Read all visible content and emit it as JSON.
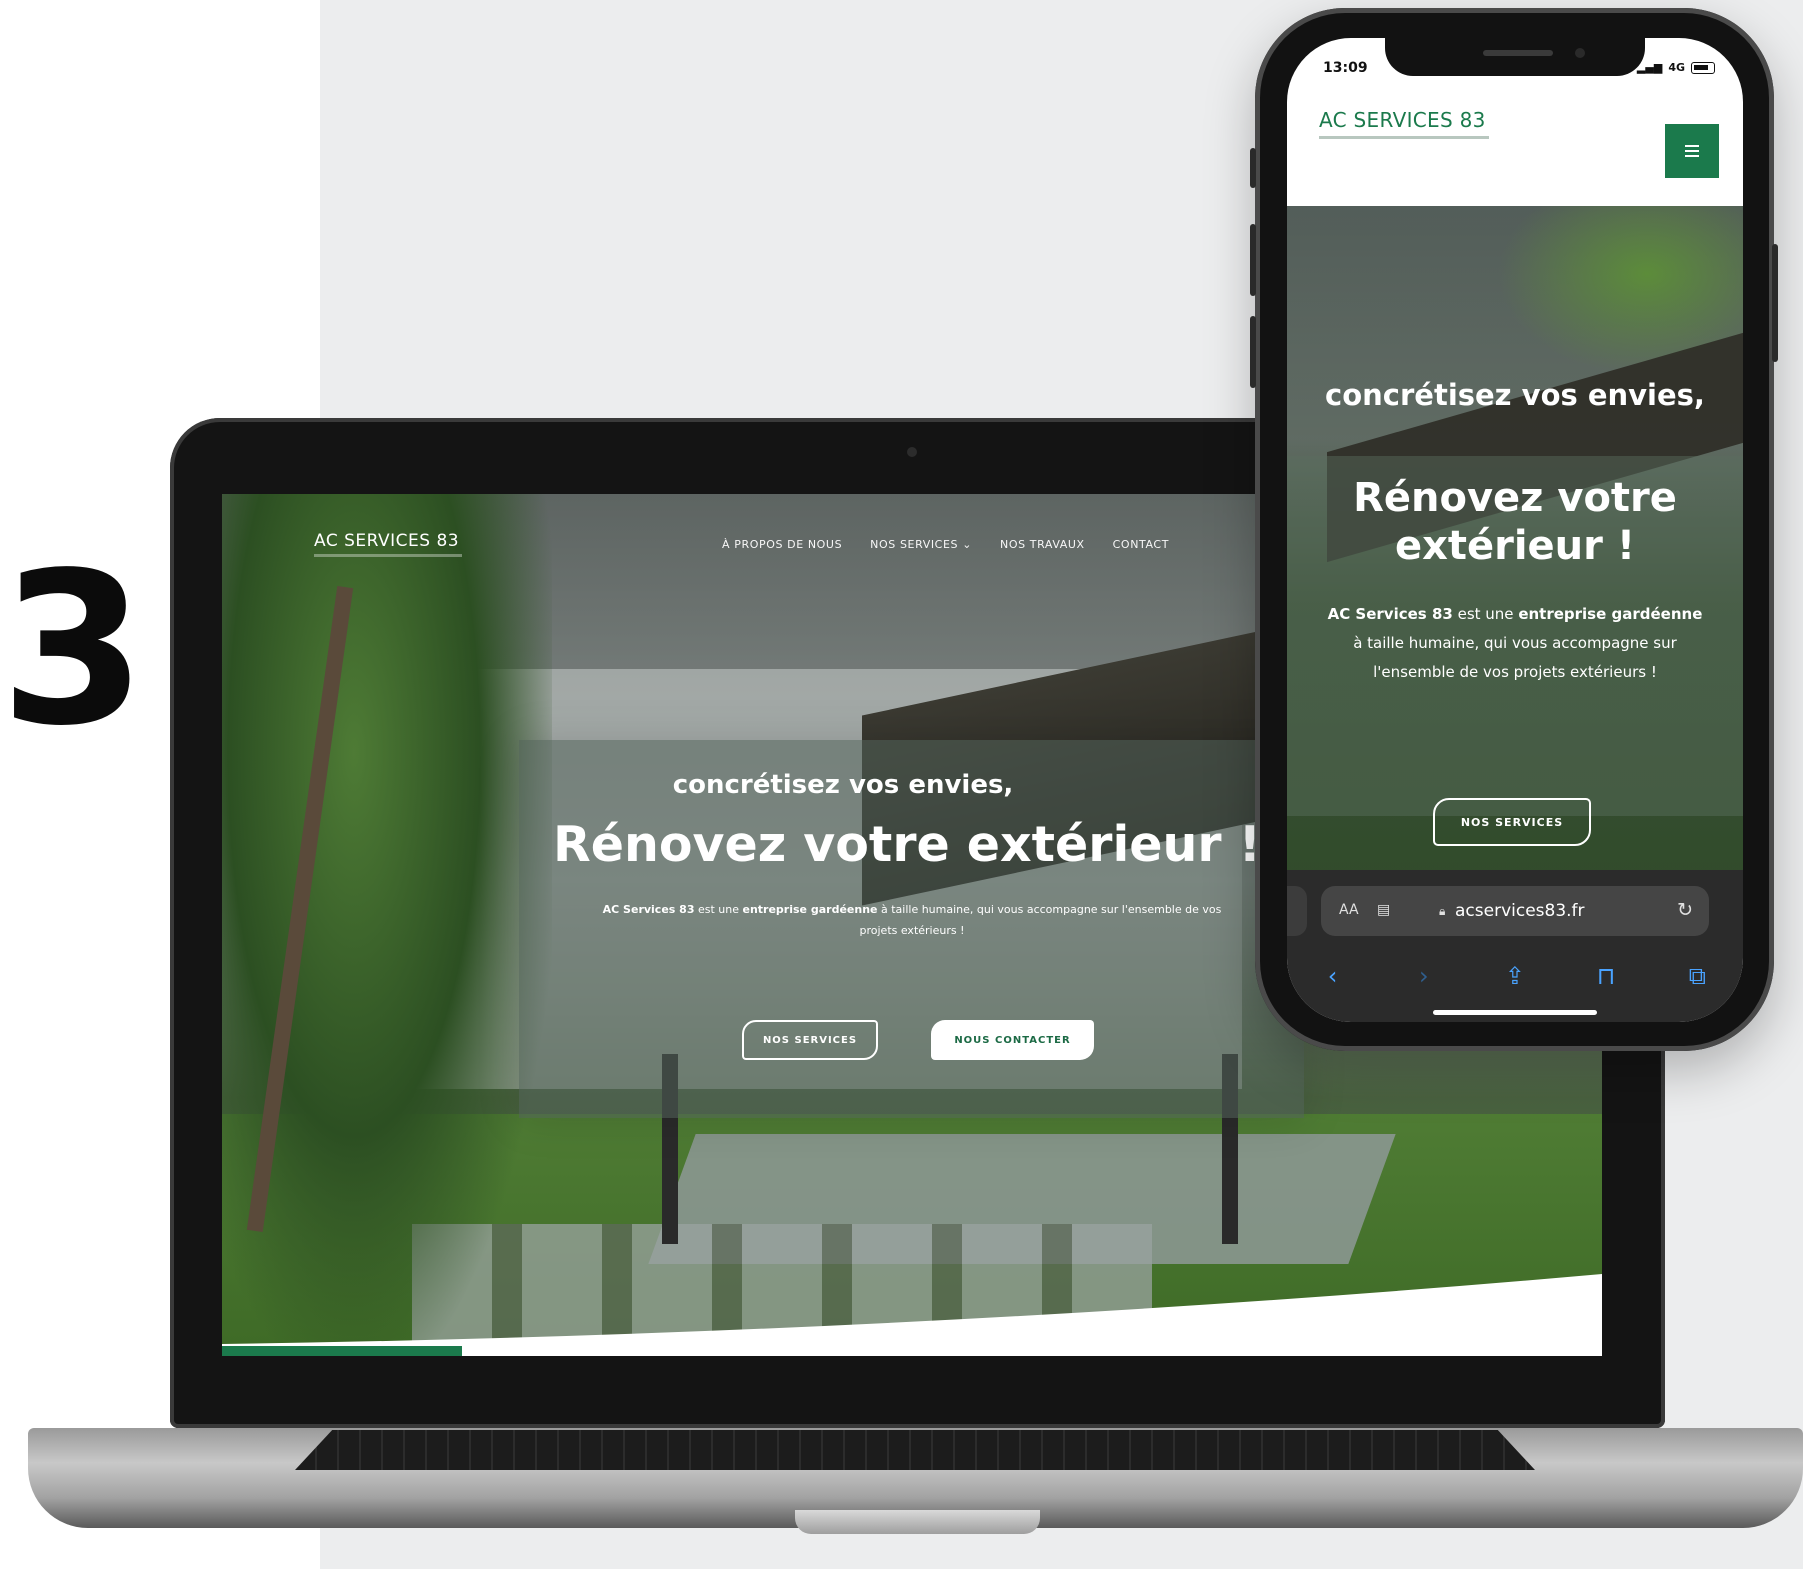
{
  "step_number": "3",
  "desktop_site": {
    "logo": "AC SERVICES 83",
    "nav": [
      {
        "label": "À PROPOS DE NOUS"
      },
      {
        "label": "NOS SERVICES ⌄"
      },
      {
        "label": "NOS TRAVAUX"
      },
      {
        "label": "CONTACT"
      }
    ],
    "hero": {
      "kicker": "concrétisez vos envies,",
      "title": "Rénovez votre extérieur !",
      "desc_part1": "AC Services 83",
      "desc_part2": " est une ",
      "desc_part3": "entreprise gardéenne",
      "desc_part4": " à taille humaine, qui vous accompagne sur l'ensemble de vos projets extérieurs !",
      "btn_services": "NOS SERVICES",
      "btn_contact": "NOUS CONTACTER"
    }
  },
  "mobile_site": {
    "status_time": "13:09",
    "status_network": "4G",
    "logo": "AC SERVICES 83",
    "hero": {
      "kicker": "concrétisez vos envies,",
      "title": "Rénovez votre extérieur !",
      "desc_part1": "AC Services 83",
      "desc_part2": " est une ",
      "desc_part3": "entreprise gardéenne",
      "desc_part4": " à taille humaine, qui vous accompagne sur l'ensemble de vos projets extérieurs !",
      "btn_services": "NOS SERVICES"
    },
    "browser": {
      "text_size": "AA",
      "domain": "acservices83.fr"
    }
  },
  "colors": {
    "brand_green": "#1b7a4c",
    "background_panel": "#ecedee"
  },
  "icons": [
    "hamburger-menu-icon",
    "lock-icon",
    "reader-icon",
    "reload-icon",
    "back-icon",
    "forward-icon",
    "share-icon",
    "bookmarks-icon",
    "tabs-icon",
    "battery-icon"
  ]
}
